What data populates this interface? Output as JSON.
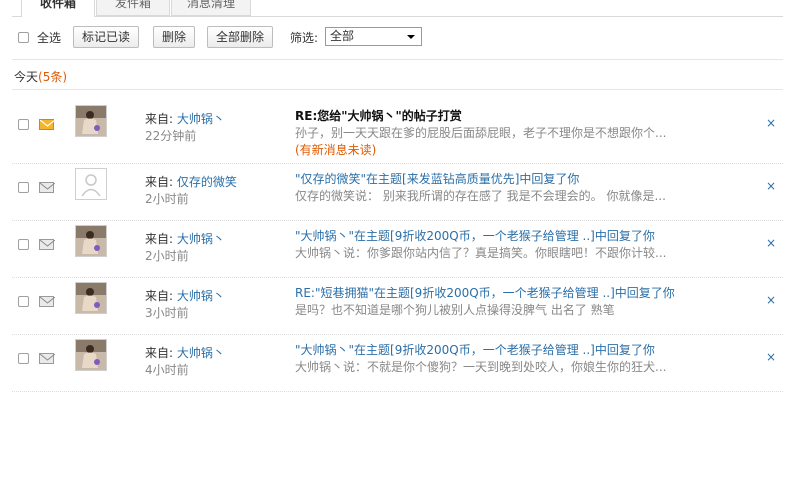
{
  "tabs": [
    "收件箱",
    "发件箱",
    "消息清理"
  ],
  "toolbar": {
    "select_all_label": "全选",
    "mark_read": "标记已读",
    "delete": "删除",
    "delete_all": "全部删除",
    "filter_label": "筛选:",
    "filter_value": "全部"
  },
  "group": {
    "label": "今天",
    "count": "(5条)"
  },
  "messages": [
    {
      "from_label": "来自:",
      "from_name": "大帅锅丶",
      "time": "22分钟前",
      "subject": "RE:您给\"大帅锅丶\"的帖子打赏",
      "preview": "孙子，别一天天跟在爹的屁股后面舔屁眼，老子不理你是不想跟你个...",
      "new_flag": "(有新消息未读)",
      "unread": true,
      "avatar": "photo",
      "close": "×"
    },
    {
      "from_label": "来自:",
      "from_name": "仅存的微笑",
      "time": "2小时前",
      "subject": "\"仅存的微笑\"在主题[来发蓝钻高质量优先]中回复了你",
      "preview": "仅存的微笑说：   别来我所谓的存在感了 我是不会理会的。 你就像是...",
      "unread": false,
      "avatar": "default",
      "close": "×"
    },
    {
      "from_label": "来自:",
      "from_name": "大帅锅丶",
      "time": "2小时前",
      "subject": "\"大帅锅丶\"在主题[9折收200Q币，一个老猴子给管理 ..]中回复了你",
      "preview": "大帅锅丶说：你爹跟你站内信了？真是搞笑。你眼瞎吧！不跟你计较...",
      "unread": false,
      "avatar": "photo",
      "close": "×"
    },
    {
      "from_label": "来自:",
      "from_name": "大帅锅丶",
      "time": "3小时前",
      "subject": "RE:\"短巷拥猫\"在主题[9折收200Q币，一个老猴子给管理 ..]中回复了你",
      "preview": "是吗？也不知道是哪个狗儿被别人点操得没脾气 出名了 熟笔",
      "unread": false,
      "avatar": "photo",
      "close": "×"
    },
    {
      "from_label": "来自:",
      "from_name": "大帅锅丶",
      "time": "4小时前",
      "subject": "\"大帅锅丶\"在主题[9折收200Q币，一个老猴子给管理 ..]中回复了你",
      "preview": "大帅锅丶说：不就是你个傻狗？一天到晚到处咬人，你娘生你的狂犬...",
      "unread": false,
      "avatar": "photo",
      "close": "×"
    }
  ]
}
